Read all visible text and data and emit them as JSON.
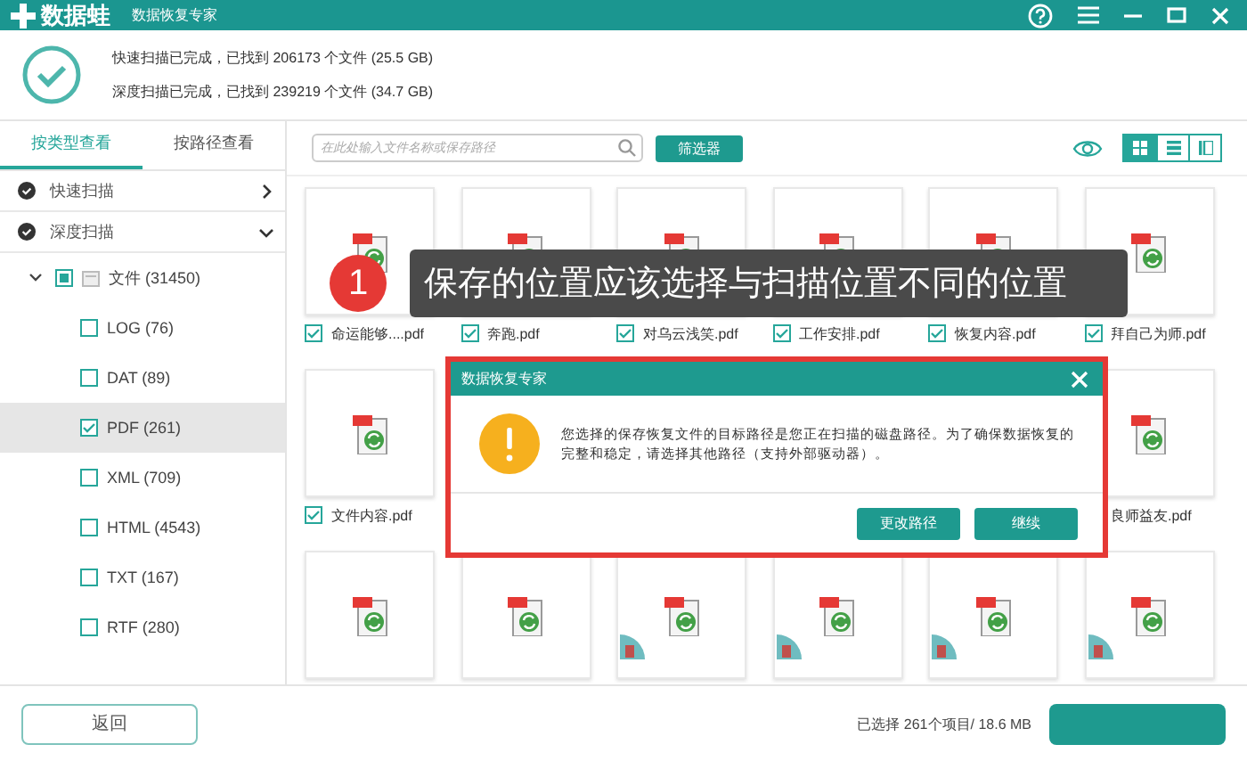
{
  "window": {
    "app_name": "数据蛙",
    "title": "数据恢复专家"
  },
  "scan_summary": [
    {
      "text": "快速扫描已完成，已找到 206173 个文件 (25.5 GB)"
    },
    {
      "text": "深度扫描已完成，已找到 239219 个文件 (34.7 GB)"
    }
  ],
  "view_tabs": [
    {
      "label": "按类型查看",
      "selected": true
    },
    {
      "label": "按路径查看",
      "selected": false
    }
  ],
  "scan_groups": [
    {
      "label": "快速扫描",
      "expanded": false
    },
    {
      "label": "深度扫描",
      "expanded": true,
      "children": [
        {
          "label": "文件 (31450)",
          "expanded": true,
          "mixed": true,
          "selected": false,
          "children": [
            {
              "label": "LOG (76)",
              "checked": false,
              "selected": false
            },
            {
              "label": "DAT (89)",
              "checked": false,
              "selected": false
            },
            {
              "label": "PDF (261)",
              "checked": true,
              "selected": true
            },
            {
              "label": "XML (709)",
              "checked": false,
              "selected": false
            },
            {
              "label": "HTML (4543)",
              "checked": false,
              "selected": false
            },
            {
              "label": "TXT (167)",
              "checked": false,
              "selected": false
            },
            {
              "label": "RTF (280)",
              "checked": false,
              "selected": false
            }
          ]
        }
      ]
    }
  ],
  "toolbar": {
    "search": {
      "placeholder": "在此处输入文件名称或保存路径"
    },
    "filter_button": "筛选器",
    "view_modes": [
      {
        "selected": true
      },
      {
        "selected": false
      },
      {
        "selected": false
      }
    ]
  },
  "file_rows": [
    {
      "tiles": [
        {
          "label": "命运能够....pdf",
          "checked": true,
          "badge": false
        },
        {
          "label": "奔跑.pdf",
          "checked": true,
          "badge": false
        },
        {
          "label": "对乌云浅笑.pdf",
          "checked": true,
          "badge": false
        },
        {
          "label": "工作安排.pdf",
          "checked": true,
          "badge": false
        },
        {
          "label": "恢复内容.pdf",
          "checked": true,
          "badge": false
        },
        {
          "label": "拜自己为师.pdf",
          "checked": true,
          "badge": false
        }
      ]
    },
    {
      "tiles": [
        {
          "label": "文件内容.pdf",
          "checked": true,
          "badge": false
        },
        {
          "label": "良师益友.pdf",
          "badge": false
        }
      ]
    },
    {
      "tiles": [
        {
          "badge": false
        },
        {
          "badge": false
        },
        {
          "badge": true
        },
        {
          "badge": true
        },
        {
          "badge": true
        },
        {
          "badge": true
        }
      ]
    }
  ],
  "footer": {
    "back_button": "返回",
    "status": "已选择 261个项目/ 18.6 MB"
  },
  "tooltip": {
    "step": "1",
    "text": "保存的位置应该选择与扫描位置不同的位置"
  },
  "dialog": {
    "title": "数据恢复专家",
    "message": "您选择的保存恢复文件的目标路径是您正在扫描的磁盘路径。为了确保数据恢复的完整和稳定，请选择其他路径（支持外部驱动器）。",
    "buttons": [
      "更改路径",
      "继续"
    ]
  }
}
